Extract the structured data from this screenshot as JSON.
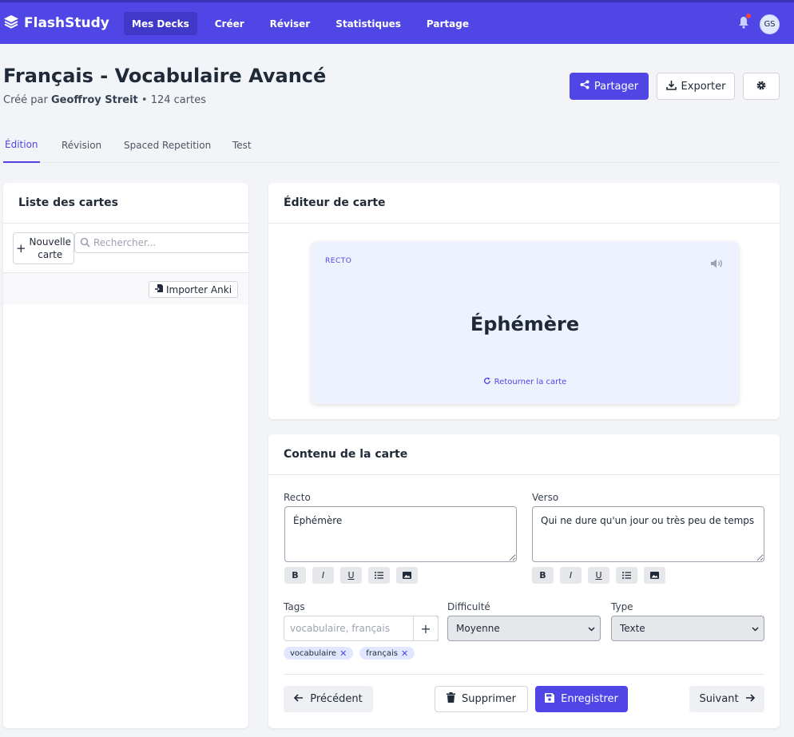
{
  "app": {
    "name": "FlashStudy",
    "brand_color": "#4f46e5"
  },
  "nav": {
    "items": [
      {
        "label": "Mes Decks",
        "active": true
      },
      {
        "label": "Créer",
        "active": false
      },
      {
        "label": "Réviser",
        "active": false
      },
      {
        "label": "Statistiques",
        "active": false
      },
      {
        "label": "Partage",
        "active": false
      }
    ],
    "avatar_initials": "GS",
    "has_notification": true
  },
  "deck": {
    "title": "Français - Vocabulaire Avancé",
    "created_by_prefix": "Créé par",
    "author": "Geoffroy Streit",
    "card_count": "• 124 cartes"
  },
  "actions": {
    "share": "Partager",
    "export": "Exporter",
    "settings_icon": "gear-icon"
  },
  "tabs": [
    {
      "label": "Édition",
      "active": true
    },
    {
      "label": "Révision",
      "active": false
    },
    {
      "label": "Spaced Repetition",
      "active": false
    },
    {
      "label": "Test",
      "active": false
    }
  ],
  "card_list": {
    "title": "Liste des cartes",
    "new_card_line1": "Nouvelle",
    "new_card_line2": "carte",
    "search_placeholder": "Rechercher...",
    "import_label": "Importer Anki"
  },
  "editor": {
    "title": "Éditeur de carte",
    "side_label": "RECTO",
    "word": "Éphémère",
    "flip_label": "Retourner la carte"
  },
  "content": {
    "title": "Contenu de la carte",
    "recto_label": "Recto",
    "recto_value": "Éphémère",
    "verso_label": "Verso",
    "verso_value": "Qui ne dure qu'un jour ou très peu de temps",
    "tags_label": "Tags",
    "tags_placeholder": "vocabulaire, français",
    "tags": [
      "vocabulaire",
      "français"
    ],
    "difficulty_label": "Difficulté",
    "difficulty_value": "Moyenne",
    "type_label": "Type",
    "type_value": "Texte",
    "prev": "Précédent",
    "delete": "Supprimer",
    "save": "Enregistrer",
    "next": "Suivant"
  }
}
